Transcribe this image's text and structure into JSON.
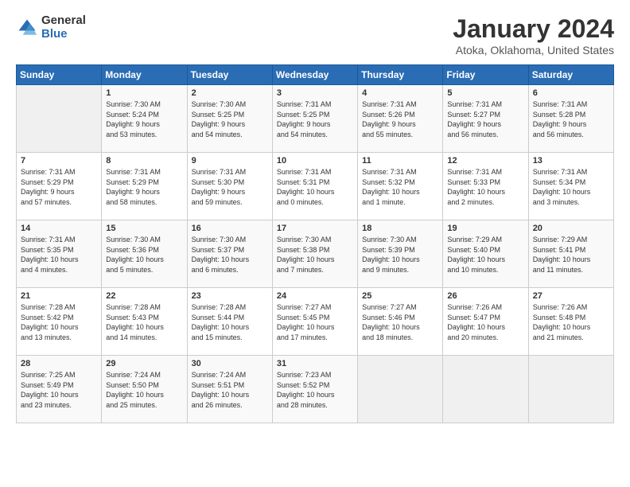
{
  "logo": {
    "general": "General",
    "blue": "Blue"
  },
  "title": {
    "month": "January 2024",
    "location": "Atoka, Oklahoma, United States"
  },
  "weekdays": [
    "Sunday",
    "Monday",
    "Tuesday",
    "Wednesday",
    "Thursday",
    "Friday",
    "Saturday"
  ],
  "weeks": [
    [
      {
        "day": "",
        "info": ""
      },
      {
        "day": "1",
        "info": "Sunrise: 7:30 AM\nSunset: 5:24 PM\nDaylight: 9 hours\nand 53 minutes."
      },
      {
        "day": "2",
        "info": "Sunrise: 7:30 AM\nSunset: 5:25 PM\nDaylight: 9 hours\nand 54 minutes."
      },
      {
        "day": "3",
        "info": "Sunrise: 7:31 AM\nSunset: 5:25 PM\nDaylight: 9 hours\nand 54 minutes."
      },
      {
        "day": "4",
        "info": "Sunrise: 7:31 AM\nSunset: 5:26 PM\nDaylight: 9 hours\nand 55 minutes."
      },
      {
        "day": "5",
        "info": "Sunrise: 7:31 AM\nSunset: 5:27 PM\nDaylight: 9 hours\nand 56 minutes."
      },
      {
        "day": "6",
        "info": "Sunrise: 7:31 AM\nSunset: 5:28 PM\nDaylight: 9 hours\nand 56 minutes."
      }
    ],
    [
      {
        "day": "7",
        "info": "Sunrise: 7:31 AM\nSunset: 5:29 PM\nDaylight: 9 hours\nand 57 minutes."
      },
      {
        "day": "8",
        "info": "Sunrise: 7:31 AM\nSunset: 5:29 PM\nDaylight: 9 hours\nand 58 minutes."
      },
      {
        "day": "9",
        "info": "Sunrise: 7:31 AM\nSunset: 5:30 PM\nDaylight: 9 hours\nand 59 minutes."
      },
      {
        "day": "10",
        "info": "Sunrise: 7:31 AM\nSunset: 5:31 PM\nDaylight: 10 hours\nand 0 minutes."
      },
      {
        "day": "11",
        "info": "Sunrise: 7:31 AM\nSunset: 5:32 PM\nDaylight: 10 hours\nand 1 minute."
      },
      {
        "day": "12",
        "info": "Sunrise: 7:31 AM\nSunset: 5:33 PM\nDaylight: 10 hours\nand 2 minutes."
      },
      {
        "day": "13",
        "info": "Sunrise: 7:31 AM\nSunset: 5:34 PM\nDaylight: 10 hours\nand 3 minutes."
      }
    ],
    [
      {
        "day": "14",
        "info": "Sunrise: 7:31 AM\nSunset: 5:35 PM\nDaylight: 10 hours\nand 4 minutes."
      },
      {
        "day": "15",
        "info": "Sunrise: 7:30 AM\nSunset: 5:36 PM\nDaylight: 10 hours\nand 5 minutes."
      },
      {
        "day": "16",
        "info": "Sunrise: 7:30 AM\nSunset: 5:37 PM\nDaylight: 10 hours\nand 6 minutes."
      },
      {
        "day": "17",
        "info": "Sunrise: 7:30 AM\nSunset: 5:38 PM\nDaylight: 10 hours\nand 7 minutes."
      },
      {
        "day": "18",
        "info": "Sunrise: 7:30 AM\nSunset: 5:39 PM\nDaylight: 10 hours\nand 9 minutes."
      },
      {
        "day": "19",
        "info": "Sunrise: 7:29 AM\nSunset: 5:40 PM\nDaylight: 10 hours\nand 10 minutes."
      },
      {
        "day": "20",
        "info": "Sunrise: 7:29 AM\nSunset: 5:41 PM\nDaylight: 10 hours\nand 11 minutes."
      }
    ],
    [
      {
        "day": "21",
        "info": "Sunrise: 7:28 AM\nSunset: 5:42 PM\nDaylight: 10 hours\nand 13 minutes."
      },
      {
        "day": "22",
        "info": "Sunrise: 7:28 AM\nSunset: 5:43 PM\nDaylight: 10 hours\nand 14 minutes."
      },
      {
        "day": "23",
        "info": "Sunrise: 7:28 AM\nSunset: 5:44 PM\nDaylight: 10 hours\nand 15 minutes."
      },
      {
        "day": "24",
        "info": "Sunrise: 7:27 AM\nSunset: 5:45 PM\nDaylight: 10 hours\nand 17 minutes."
      },
      {
        "day": "25",
        "info": "Sunrise: 7:27 AM\nSunset: 5:46 PM\nDaylight: 10 hours\nand 18 minutes."
      },
      {
        "day": "26",
        "info": "Sunrise: 7:26 AM\nSunset: 5:47 PM\nDaylight: 10 hours\nand 20 minutes."
      },
      {
        "day": "27",
        "info": "Sunrise: 7:26 AM\nSunset: 5:48 PM\nDaylight: 10 hours\nand 21 minutes."
      }
    ],
    [
      {
        "day": "28",
        "info": "Sunrise: 7:25 AM\nSunset: 5:49 PM\nDaylight: 10 hours\nand 23 minutes."
      },
      {
        "day": "29",
        "info": "Sunrise: 7:24 AM\nSunset: 5:50 PM\nDaylight: 10 hours\nand 25 minutes."
      },
      {
        "day": "30",
        "info": "Sunrise: 7:24 AM\nSunset: 5:51 PM\nDaylight: 10 hours\nand 26 minutes."
      },
      {
        "day": "31",
        "info": "Sunrise: 7:23 AM\nSunset: 5:52 PM\nDaylight: 10 hours\nand 28 minutes."
      },
      {
        "day": "",
        "info": ""
      },
      {
        "day": "",
        "info": ""
      },
      {
        "day": "",
        "info": ""
      }
    ]
  ]
}
